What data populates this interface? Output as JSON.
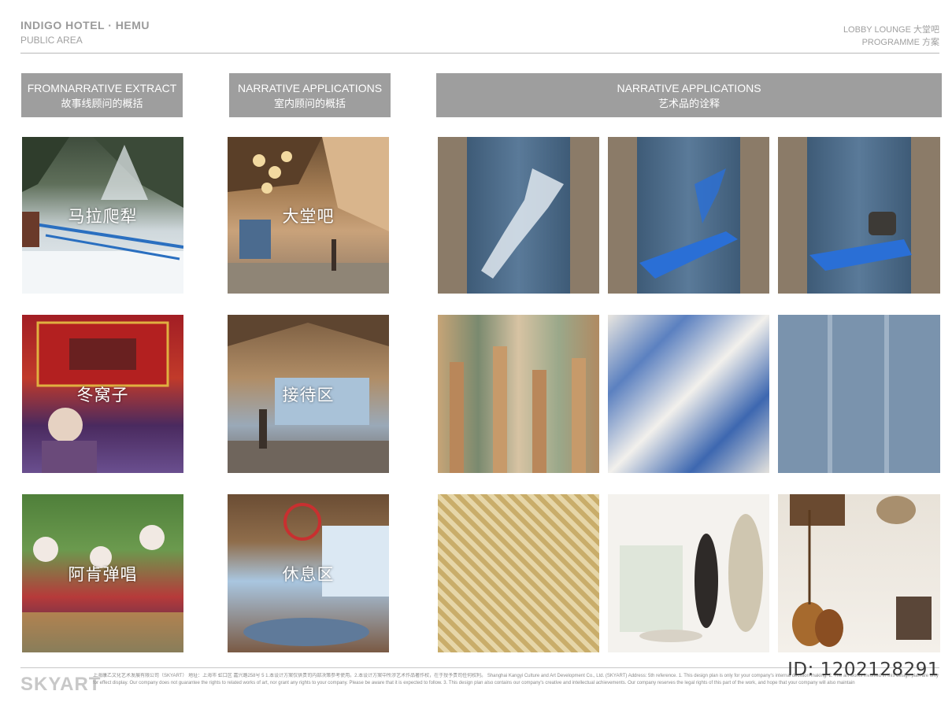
{
  "header": {
    "title": "INDIGO HOTEL · HEMU",
    "subtitle": "PUBLIC AREA",
    "right_line1": "LOBBY LOUNGE 大堂吧",
    "right_line2": "PROGRAMME 方案"
  },
  "sections": [
    {
      "en": "FROMNARRATIVE EXTRACT",
      "cn": "故事线顾问的概括"
    },
    {
      "en": "NARRATIVE APPLICATIONS",
      "cn": "室内顾问的概括"
    },
    {
      "en": "NARRATIVE APPLICATIONS",
      "cn": "艺术品的诠释"
    }
  ],
  "tiles": {
    "r1c1": "马拉爬犁",
    "r1c2": "大堂吧",
    "r2c1": "冬窝子",
    "r2c2": "接待区",
    "r3c1": "阿肯弹唱",
    "r3c2": "休息区"
  },
  "watermark_id": "ID: 1202128291",
  "brand": "SKYART",
  "footer_text": "上海康乙文化艺术发展有限公司（SKYART） 地址：上海市 虹口区 嘉兴路258号 5 1.本设计方案仅供贵司内部决策参考使用。2.本设计方案中所涉艺术作品著作权，在于授予贵司任何权利。 Shanghai Kangyi Culture and Art Development Co., Ltd. (SKYART) Address: 5th reference. 1. This design plan is only for your company's internal decision-making. 2. The art works involved in this design plan are only for effect display. Our company does not guarantee the rights to related works of art, nor grant any rights to your company. Please be aware that it is expected to follow. 3. This design plan also contains our company's creative and intellectual achievements. Our company reserves the legal rights of this part of the work, and hope that your company will also maintain"
}
